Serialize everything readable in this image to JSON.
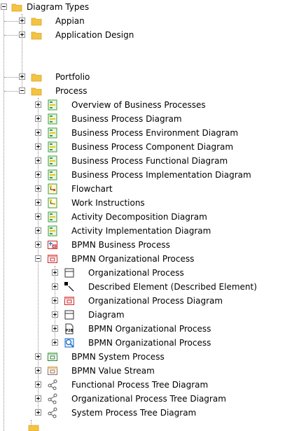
{
  "tree": {
    "root": {
      "label": "Diagram Types",
      "icon": "folder-icon"
    },
    "items": [
      {
        "label": "Appian",
        "icon": "folder-icon"
      },
      {
        "label": "Application Design",
        "icon": "folder-icon"
      },
      {
        "label": "Portfolio",
        "icon": "folder-icon"
      },
      {
        "label": "Process",
        "icon": "folder-icon"
      }
    ],
    "process_children": [
      {
        "label": "Overview of Business Processes",
        "icon": "green-diagram-icon"
      },
      {
        "label": "Business Process Diagram",
        "icon": "green-diagram-icon"
      },
      {
        "label": "Business Process Environment Diagram",
        "icon": "green-diagram-icon"
      },
      {
        "label": "Business Process Component Diagram",
        "icon": "green-diagram-icon"
      },
      {
        "label": "Business Process Functional Diagram",
        "icon": "green-diagram-icon"
      },
      {
        "label": "Business Process Implementation Diagram",
        "icon": "green-diagram-icon"
      },
      {
        "label": "Flowchart",
        "icon": "flowchart-icon"
      },
      {
        "label": "Work Instructions",
        "icon": "work-instructions-icon"
      },
      {
        "label": "Activity Decomposition Diagram",
        "icon": "green-diagram-icon"
      },
      {
        "label": "Activity Implementation Diagram",
        "icon": "green-diagram-icon"
      },
      {
        "label": "BPMN Business Process",
        "icon": "bpmn-business-process-icon"
      },
      {
        "label": "BPMN Organizational Process",
        "icon": "bpmn-organizational-process-icon"
      }
    ],
    "bpmn_org_children": [
      {
        "label": "Organizational Process",
        "icon": "class-box-icon"
      },
      {
        "label": "Described Element (Described Element)",
        "icon": "pointer-icon"
      },
      {
        "label": "Organizational Process Diagram",
        "icon": "bpmn-organizational-process-icon"
      },
      {
        "label": "Diagram",
        "icon": "class-box-icon"
      },
      {
        "label": "BPMN Organizational Process",
        "icon": "p2b-icon"
      },
      {
        "label": "BPMN Organizational Process",
        "icon": "search-diagram-icon"
      }
    ],
    "process_children_after": [
      {
        "label": "BPMN System Process",
        "icon": "bpmn-system-process-icon"
      },
      {
        "label": "BPMN Value Stream",
        "icon": "bpmn-value-stream-icon"
      },
      {
        "label": "Functional Process Tree Diagram",
        "icon": "process-tree-icon"
      },
      {
        "label": "Organizational Process Tree Diagram",
        "icon": "process-tree-icon"
      },
      {
        "label": "System Process Tree Diagram",
        "icon": "process-tree-icon"
      }
    ]
  },
  "colors": {
    "folder": "#f5c342",
    "diagram_green": "#3f9b3f",
    "tree_line": "#8c8c8c"
  }
}
